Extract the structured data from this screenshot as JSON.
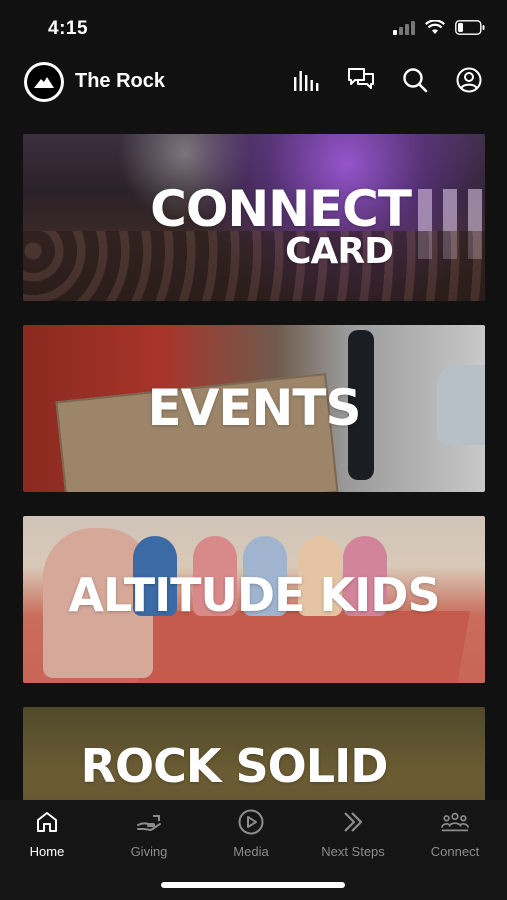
{
  "status_bar": {
    "time": "4:15"
  },
  "header": {
    "app_title": "The Rock"
  },
  "feed": {
    "cards": [
      {
        "title_line1": "CONNECT",
        "title_line2": "CARD"
      },
      {
        "title": "EVENTS"
      },
      {
        "title": "ALTITUDE KIDS"
      },
      {
        "title": "ROCK SOLID"
      }
    ]
  },
  "tab_bar": {
    "tabs": [
      {
        "label": "Home",
        "icon": "home-icon",
        "active": true
      },
      {
        "label": "Giving",
        "icon": "giving-icon",
        "active": false
      },
      {
        "label": "Media",
        "icon": "play-icon",
        "active": false
      },
      {
        "label": "Next Steps",
        "icon": "chevrons-right-icon",
        "active": false
      },
      {
        "label": "Connect",
        "icon": "group-icon",
        "active": false
      }
    ]
  },
  "colors": {
    "background": "#111111",
    "tab_bar": "#151515",
    "inactive": "#8c8c8c",
    "active": "#ffffff"
  }
}
